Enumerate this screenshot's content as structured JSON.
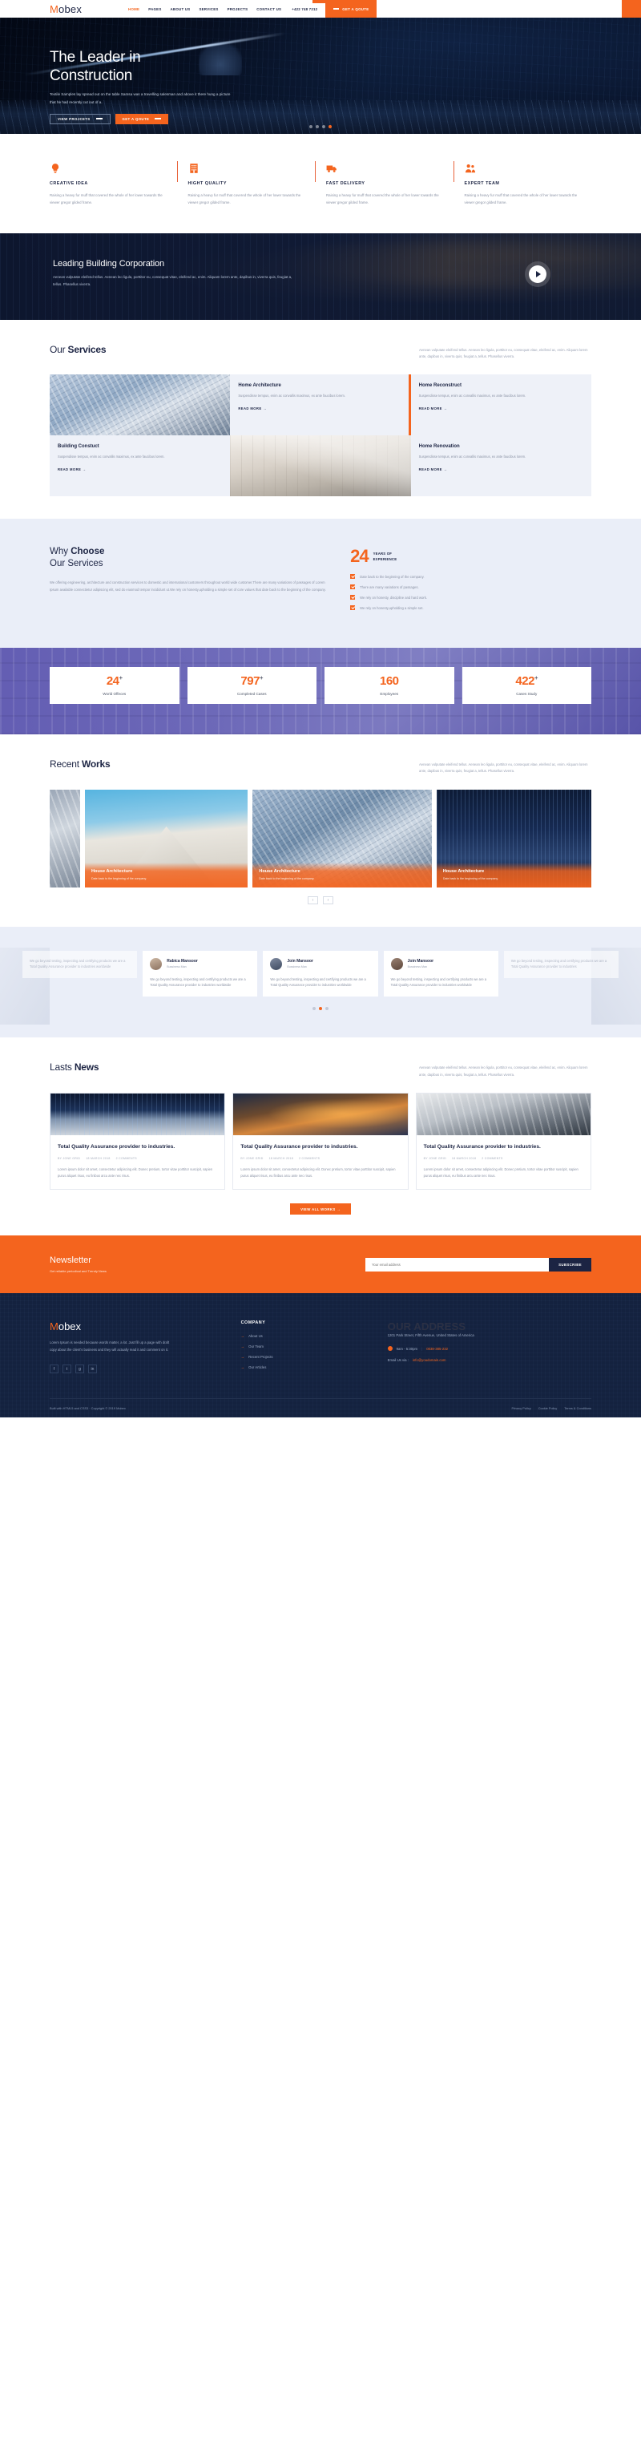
{
  "brand": {
    "name": "Mobex",
    "first_letter": "M",
    "rest": "obex"
  },
  "header": {
    "nav": [
      {
        "label": "HOME",
        "active": true
      },
      {
        "label": "PAGES",
        "active": false
      },
      {
        "label": "ABOUT US",
        "active": false
      },
      {
        "label": "SERVICES",
        "active": false
      },
      {
        "label": "PROJECTS",
        "active": false
      },
      {
        "label": "CONTACT US",
        "active": false
      }
    ],
    "phone": "+422 748 7212",
    "quote_label": "GET A QOUTE"
  },
  "hero": {
    "title_line1": "The Leader in",
    "title_line2": "Construction",
    "paragraph": "Textile Samples lay spread out on the table Samsa was a travelling salesman and above it there hung a picture that he had recently cut out of a.",
    "btn_primary": "VIEW PROJCETS",
    "btn_secondary": "GET A QOUTE",
    "slide_dots": 4,
    "active_dot": 3
  },
  "features": [
    {
      "icon": "lightbulb-icon",
      "title": "CREATIVE IDEA",
      "text": "Raising a heavy fur muff that covered the whole of her lower towards the viewer gregor gilded frame."
    },
    {
      "icon": "building-icon",
      "title": "HIGHT QUALITY",
      "text": "Raising a heavy fur muff that covered the whole of her lower towards the viewer gregor gilded frame."
    },
    {
      "icon": "truck-icon",
      "title": "FAST DELIVERY",
      "text": "Raising a heavy fur muff that covered the whole of her lower towards the viewer gregor gilded frame."
    },
    {
      "icon": "team-icon",
      "title": "EXPERT TEAM",
      "text": "Raising a heavy fur muff that covered the whole of her lower towards the viewer gregor gilded frame."
    }
  ],
  "video_banner": {
    "title": "Leading Building Corporation",
    "text": "Aenean vulputate eleifend tellus. Aenean leo ligula, porttitor eu, consequat vitae, eleifend ac, enim. Aliquam lorem ante, dapibus in, viverra quis, feugiat a, tellus. Phasellus viverra.",
    "play_label": "play-button"
  },
  "services": {
    "title_normal": "Our ",
    "title_bold": "Services",
    "subtitle": "Aenean vulputate eleifend tellus. Aenean leo ligula, porttitor eu, consequat vitae, eleifend ac, enim. Aliquam lorem ante, dapibus in, viverra quis, feugiat a, tellus. Phasellus viverra.",
    "read_more": "READ MORE →",
    "cards": [
      {
        "title": "Home Architecture",
        "text": "Suspendisse tempus, enim ac convallis maximus, ex ante faucibus lorem."
      },
      {
        "title": "Home Reconstruct",
        "text": "Suspendisse tempus, enim ac convallis maximus, ex ante faucibus lorem."
      },
      {
        "title": "Building Constuct",
        "text": "Suspendisse tempus, enim ac convallis maximus, ex ante faucibus lorem."
      },
      {
        "title": "Home Renovation",
        "text": "Suspendisse tempus, enim ac convallis maximus, ex ante faucibus lorem."
      }
    ]
  },
  "why": {
    "title_l1_normal": "Why ",
    "title_l1_bold": "Choose",
    "title_l2": "Our Services",
    "paragraph": "We offering engineering, architecture and construction services to domestic and international customers throughout world wide customer.There are many variations of passages of Lorem Ipsum available connectietur adipiscing elit, sed do eiusmod tempor incididunt ut.We rely on honesty,upholding a simple set of core values that date back to the beginning of the company.",
    "years_number": "24",
    "years_label_l1": "YEARS OF",
    "years_label_l2": "EXPERIENCE",
    "checklist": [
      "Date back to the beginning of the company.",
      "There are many variations of passages.",
      "We rely on honesty, discipline and hard work.",
      "We rely on honesty,upholding a simple set."
    ]
  },
  "counters": [
    {
      "value": "24",
      "suffix": "+",
      "label": "World Offeces"
    },
    {
      "value": "797",
      "suffix": "+",
      "label": "Completed Cases"
    },
    {
      "value": "160",
      "suffix": "",
      "label": "Employees"
    },
    {
      "value": "422",
      "suffix": "+",
      "label": "Cases Study"
    }
  ],
  "works": {
    "title_normal": "Recent ",
    "title_bold": "Works",
    "subtitle": "Aenean vulputate eleifend tellus. Aenean leo ligula, porttitor eu, consequat vitae, eleifend ac, enim. Aliquam lorem ante, dapibus in, viverra quis, feugiat a, tellus. Phasellus viverra.",
    "items": [
      {
        "title": "House Architecture",
        "meta": "Date back to the beginning of the company."
      },
      {
        "title": "House Architecture",
        "meta": "Date back to the beginning of the company."
      },
      {
        "title": "House Architecture",
        "meta": "Date back to the beginning of the company."
      }
    ],
    "prev": "‹",
    "next": "›"
  },
  "testimonials": {
    "items": [
      {
        "name": "Rabica Mansoor",
        "role": "Bussiness Man",
        "quote": "We go beyond testing, inspecting and certifying products we are a Total Quality Assurance provider to industries worldwide"
      },
      {
        "name": "Join Mansoor",
        "role": "Bussiness Man",
        "quote": "We go beyond testing, inspecting and certifying products we are a Total Quality Assurance provider to industries worldwide"
      },
      {
        "name": "Join Mansoor",
        "role": "Bussiness Man",
        "quote": "We go beyond testing, inspecting and certifying products we are a Total Quality Assurance provider to industries worldwide"
      }
    ],
    "side_left": "We go beyond testing, inspecting and certifying products we are a Total Quality Assurance provider to industries worldwide",
    "side_right": "We go beyond testing, inspecting and certifying products we are a Total Quality Assurance provider to industries",
    "dots": 3,
    "active_dot": 1
  },
  "news": {
    "title_normal": "Lasts ",
    "title_bold": "News",
    "subtitle": "Aenean vulputate eleifend tellus. Aenean leo ligula, porttitor eu, consequat vitae, eleifend ac, enim. Aliquam lorem ante, dapibus in, viverra quis, feugiat a, tellus. Phasellus viverra.",
    "view_all": "VIEW ALL WORKS →",
    "posts": [
      {
        "title": "Total Quality Assurance provider to industries.",
        "author": "BY JONE GRID",
        "date": "18 MARCH 2018",
        "comments": "2 COMMENTS",
        "excerpt": "Lorem ipsum dolor sit amet, consectetur adipiscing elit. Donec pretium, tortor vitae porttitor suscipit, sapien purus aliquet risus, eu finibus arcu ante nec risus."
      },
      {
        "title": "Total Quality Assurance provider to industries.",
        "author": "BY JONE GRID",
        "date": "18 MARCH 2018",
        "comments": "2 COMMENTS",
        "excerpt": "Lorem ipsum dolor sit amet, consectetur adipiscing elit. Donec pretium, tortor vitae porttitor suscipit, sapien purus aliquet risus, eu finibus arcu ante nec risus."
      },
      {
        "title": "Total Quality Assurance provider to industries.",
        "author": "BY JONE GRID",
        "date": "18 MARCH 2018",
        "comments": "2 COMMENTS",
        "excerpt": "Lorem ipsum dolor sit amet, consectetur adipiscing elit. Donec pretium, tortor vitae porttitor suscipit, sapien purus aliquet risus, eu finibus arcu ante nec risus."
      }
    ]
  },
  "newsletter": {
    "title": "Newsletter",
    "subtitle": "Get reliable periodical and Trendy News",
    "placeholder": "Your email address",
    "button": "SUBSCRIBE"
  },
  "footer": {
    "about": "Lorem Ipsum is needed because words matter, a lot. Just fill up a page with draft copy about the client's business and they will actually read it and comment on it.",
    "social": [
      "f",
      "t",
      "g",
      "in"
    ],
    "company": {
      "heading": "COMPANY",
      "links": [
        "About Us",
        "Our Team",
        "Recent Projects",
        "Our Articles"
      ]
    },
    "address": {
      "heading": "OUR ADDRESS",
      "street": "1201 Park Street, Fifth Avenue, United States of America",
      "hours": "9am - 5:30pm",
      "phone": "0038-385-232",
      "email_label": "Email Us via :",
      "email": "info@youdomain.com"
    },
    "copyright": "Built with HTML5 and CSS3 · Copyright © 2019 Mobex",
    "bottom_links": [
      "Privacy Policy",
      "Cookie Policy",
      "Terms & Conditions"
    ]
  },
  "colors": {
    "accent": "#f4641e",
    "dark": "#1c2443",
    "footer_bg": "#14223f",
    "light_bg": "#eaeef8"
  }
}
